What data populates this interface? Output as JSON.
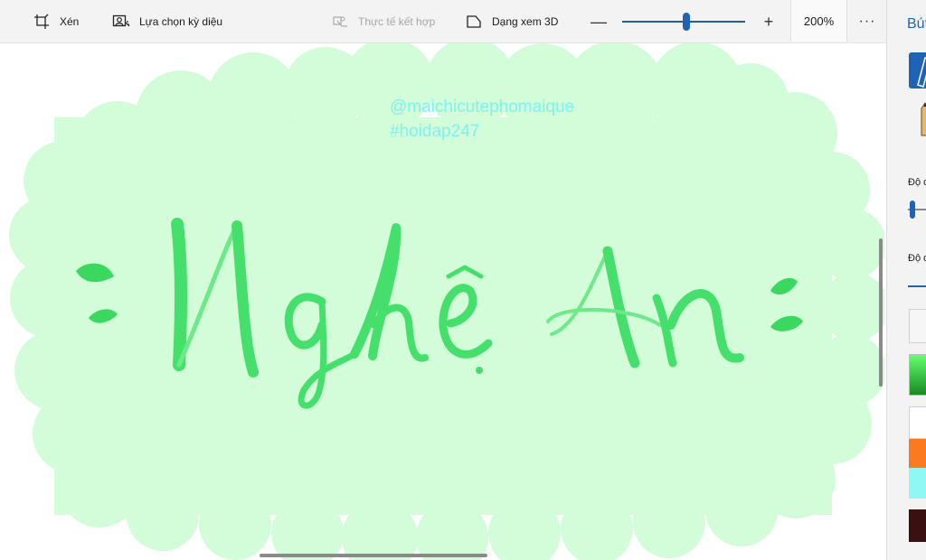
{
  "toolbar": {
    "crop_label": "Xén",
    "magic_select_label": "Lựa chọn kỳ diệu",
    "mixed_reality_label": "Thực tế kết hợp",
    "view_3d_label": "Dạng xem 3D",
    "zoom_value": "200%",
    "zoom_slider_fraction": 0.52,
    "more_label": "···"
  },
  "canvas": {
    "watermark_line1": "@maichicutephomaique",
    "watermark_line2": "#hoidap247",
    "lettering": "Nghệ An",
    "cloud_color": "#d3fcd9",
    "letter_color": "#45e06b"
  },
  "panel": {
    "title": "Bút",
    "label_thickness": "Độ d",
    "label_opacity": "Độ d",
    "thickness_fraction": 0.05,
    "colors": [
      "#f6f6f6",
      "#3fd853",
      "#ffffff",
      "#fb7a1f",
      "#8ff7f4",
      "#3a1010"
    ]
  }
}
